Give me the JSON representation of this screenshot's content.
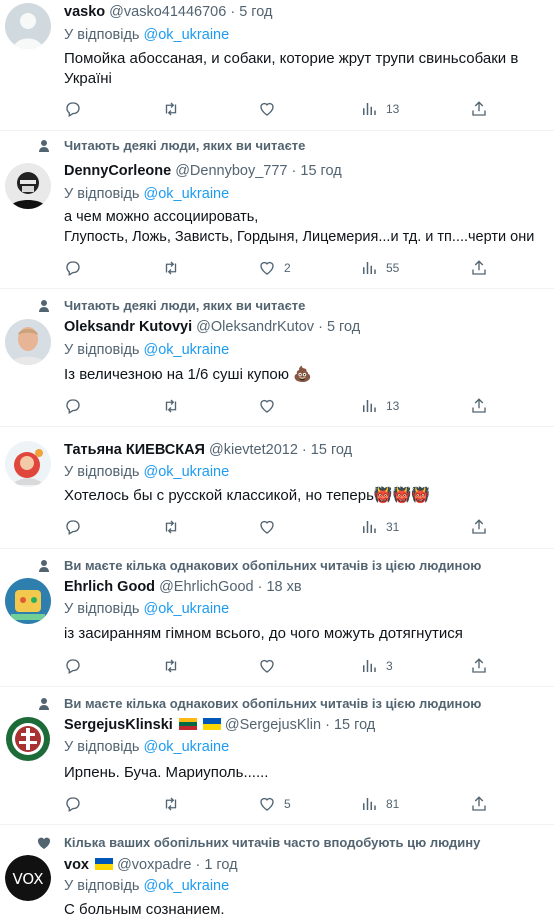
{
  "tweets": [
    {
      "name": "vasko",
      "handle": "@vasko41446706",
      "time": "5 год",
      "reply_prefix": "У відповідь",
      "reply_to": "@ok_ukraine",
      "text": "Помойка абоссаная, и собаки, которие жрут трупи свиньсобаки в Україні",
      "likes": "",
      "views": "13",
      "avatar_icon": "default-avatar-icon"
    },
    {
      "social": "Читають деякі люди, яких ви читаєте",
      "social_icon": "person-icon",
      "name": "DennyCorleone",
      "handle": "@Dennyboy_777",
      "time": "15 год",
      "reply_prefix": "У відповідь",
      "reply_to": "@ok_ukraine",
      "text": "а чем можно ассоциировать,\nГлупость, Ложь, Зависть, Гордыня, Лицемерия...и тд. и тп....черти они",
      "likes": "2",
      "views": "55",
      "avatar_icon": "masked-face-avatar"
    },
    {
      "social": "Читають деякі люди, яких ви читаєте",
      "social_icon": "person-icon",
      "name": "Oleksandr Kutovyi",
      "handle": "@OleksandrKutov",
      "time": "5 год",
      "reply_prefix": "У відповідь",
      "reply_to": "@ok_ukraine",
      "text": "Із величезною на 1/6 суші купою 💩",
      "likes": "",
      "views": "13",
      "avatar_icon": "man-portrait-avatar"
    },
    {
      "name": "Татьяна КИЕВСКАЯ",
      "handle": "@kievtet2012",
      "time": "15 год",
      "reply_prefix": "У відповідь",
      "reply_to": "@ok_ukraine",
      "text": "Хотелось бы с русской классикой, но теперь👹👹👹",
      "likes": "",
      "views": "31",
      "avatar_icon": "cartoon-avatar"
    },
    {
      "social": "Ви маєте кілька однакових обопільних читачів із цією людиною",
      "social_icon": "person-icon",
      "name": "Ehrlich Good",
      "handle": "@EhrlichGood",
      "time": "18 хв",
      "reply_prefix": "У відповідь",
      "reply_to": "@ok_ukraine",
      "text": "із засиранням гімном всього, до чого можуть дотягнутися",
      "likes": "",
      "views": "3",
      "avatar_icon": "illustration-avatar"
    },
    {
      "social": "Ви маєте кілька однакових обопільних читачів із цією людиною",
      "social_icon": "person-icon",
      "name": "SergejusKlinski",
      "handle": "@SergejusKlin",
      "time": "15 год",
      "reply_prefix": "У відповідь",
      "reply_to": "@ok_ukraine",
      "text": "Ирпень. Буча. Мариуполь......",
      "likes": "5",
      "views": "81",
      "avatar_icon": "emblem-avatar",
      "flags": [
        "lithuania-flag",
        "ukraine-flag"
      ]
    },
    {
      "social": "Кілька ваших обопільних читачів часто вподобують цю людину",
      "social_icon": "heart-icon",
      "name": "vox",
      "handle": "@voxpadre",
      "time": "1 год",
      "reply_prefix": "У відповідь",
      "reply_to": "@ok_ukraine",
      "text": "С больным сознанием.",
      "likes": "",
      "views": "",
      "avatar_icon": "vox-logo-avatar",
      "flags": [
        "ukraine-flag"
      ]
    }
  ],
  "separator": "·",
  "colors": {
    "text": "#0f1419",
    "secondary": "#536471",
    "link": "#1d9bf0",
    "border": "#eff3f4"
  },
  "vox_logo_text": "VOX"
}
